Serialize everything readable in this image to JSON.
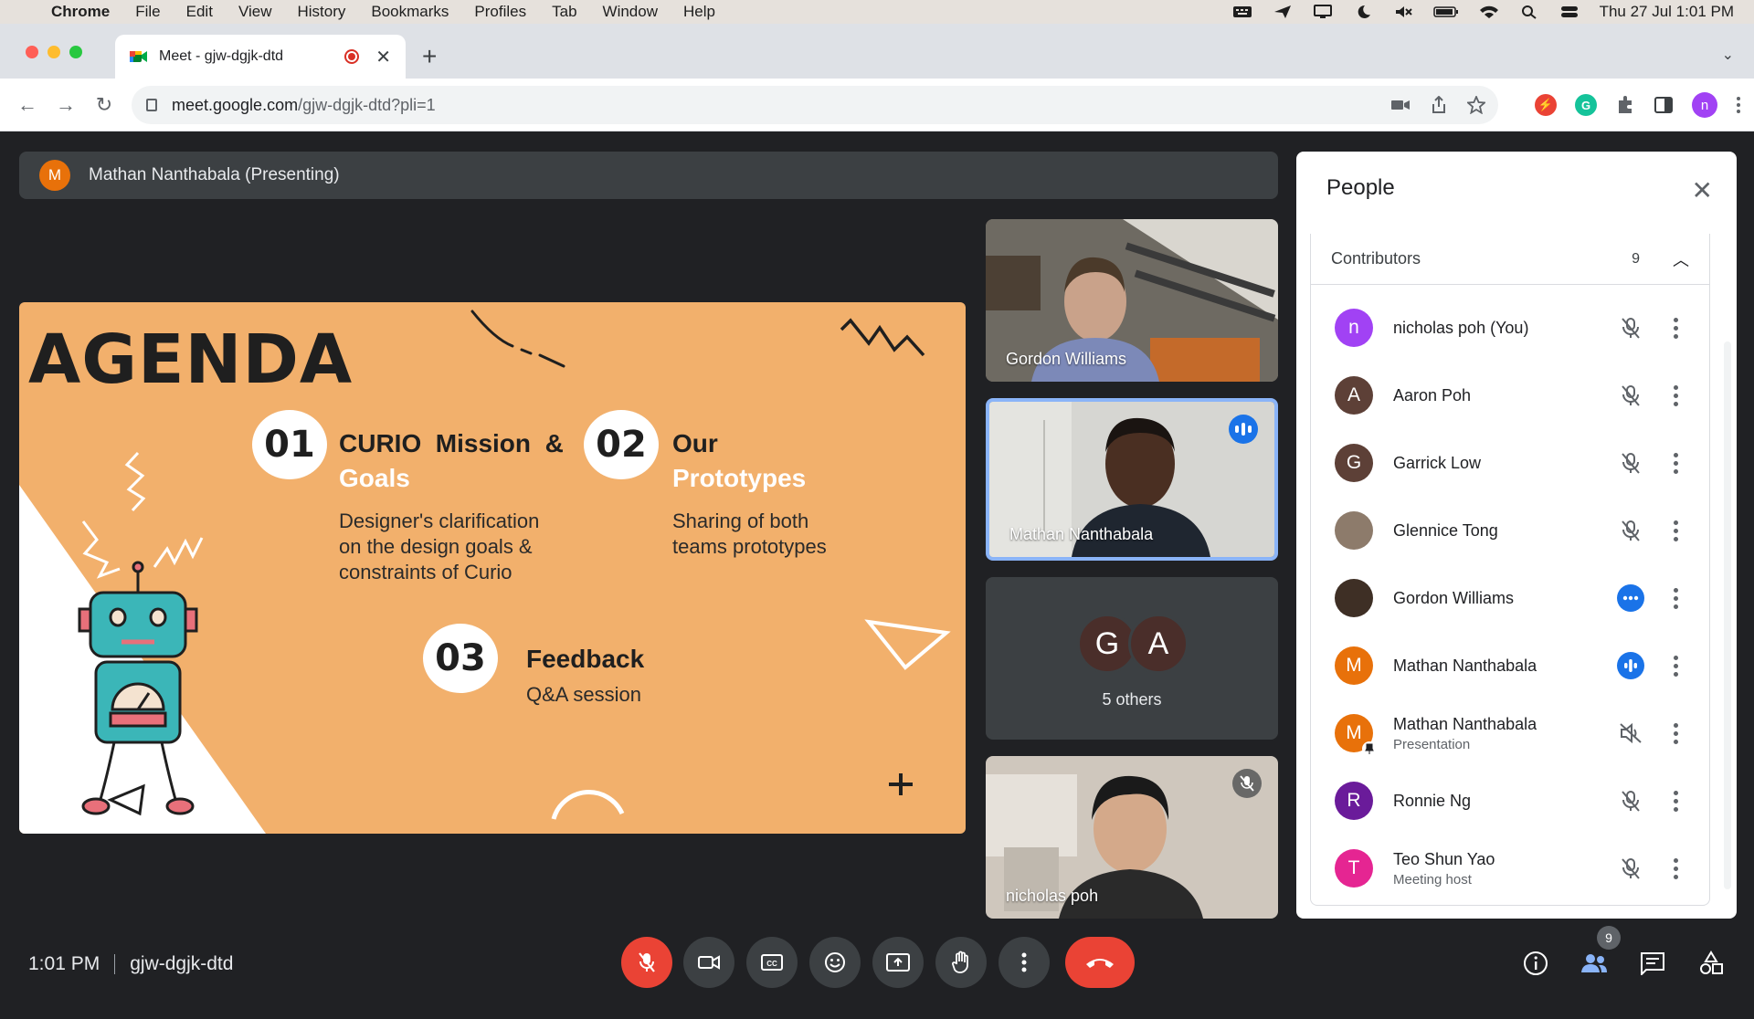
{
  "menubar": {
    "app": "Chrome",
    "items": [
      "File",
      "Edit",
      "View",
      "History",
      "Bookmarks",
      "Profiles",
      "Tab",
      "Window",
      "Help"
    ],
    "datetime": "Thu 27 Jul  1:01 PM"
  },
  "browser": {
    "tab_title": "Meet - gjw-dgjk-dtd",
    "url_host": "meet.google.com",
    "url_path": "/gjw-dgjk-dtd?pli=1",
    "profile_initial": "n"
  },
  "meet": {
    "presenting_banner": "Mathan Nanthabala (Presenting)",
    "presenter_initial": "M",
    "slide": {
      "heading": "AGENDA",
      "items": [
        {
          "num": "01",
          "title_a": "CURIO  Mission  &",
          "title_b": "Goals",
          "desc": [
            "Designer's clarification",
            "on the design goals &",
            "constraints of Curio"
          ]
        },
        {
          "num": "02",
          "title_a": "Our",
          "title_b": "Prototypes",
          "desc": [
            "Sharing of both",
            "teams prototypes"
          ]
        },
        {
          "num": "03",
          "title_a": "Feedback",
          "title_b": "",
          "desc": [
            "Q&A session"
          ]
        }
      ]
    },
    "tiles": [
      {
        "name": "Gordon Williams"
      },
      {
        "name": "Mathan Nanthabala"
      },
      {
        "name": "5 others",
        "avatars": [
          "G",
          "A"
        ]
      },
      {
        "name": "nicholas poh"
      }
    ],
    "time": "1:01 PM",
    "meeting_code": "gjw-dgjk-dtd",
    "people_badge": "9"
  },
  "people": {
    "title": "People",
    "section": "Contributors",
    "count": "9",
    "list": [
      {
        "initial": "n",
        "name": "nicholas poh (You)",
        "sub": "",
        "color": "#a142f4",
        "status": "muted"
      },
      {
        "initial": "A",
        "name": "Aaron Poh",
        "sub": "",
        "color": "#5d4037",
        "status": "muted"
      },
      {
        "initial": "G",
        "name": "Garrick Low",
        "sub": "",
        "color": "#5d4037",
        "status": "muted"
      },
      {
        "initial": "",
        "name": "Glennice Tong",
        "sub": "",
        "color": "#8d7b6b",
        "status": "muted"
      },
      {
        "initial": "",
        "name": "Gordon Williams",
        "sub": "",
        "color": "#3e2f25",
        "status": "more-blue"
      },
      {
        "initial": "M",
        "name": "Mathan Nanthabala",
        "sub": "",
        "color": "#e8710a",
        "status": "speaking"
      },
      {
        "initial": "M",
        "name": "Mathan Nanthabala",
        "sub": "Presentation",
        "color": "#e8710a",
        "status": "volume-off"
      },
      {
        "initial": "R",
        "name": "Ronnie Ng",
        "sub": "",
        "color": "#6a1b9a",
        "status": "muted"
      },
      {
        "initial": "T",
        "name": "Teo Shun Yao",
        "sub": "Meeting host",
        "color": "#e52592",
        "status": "muted"
      }
    ]
  }
}
